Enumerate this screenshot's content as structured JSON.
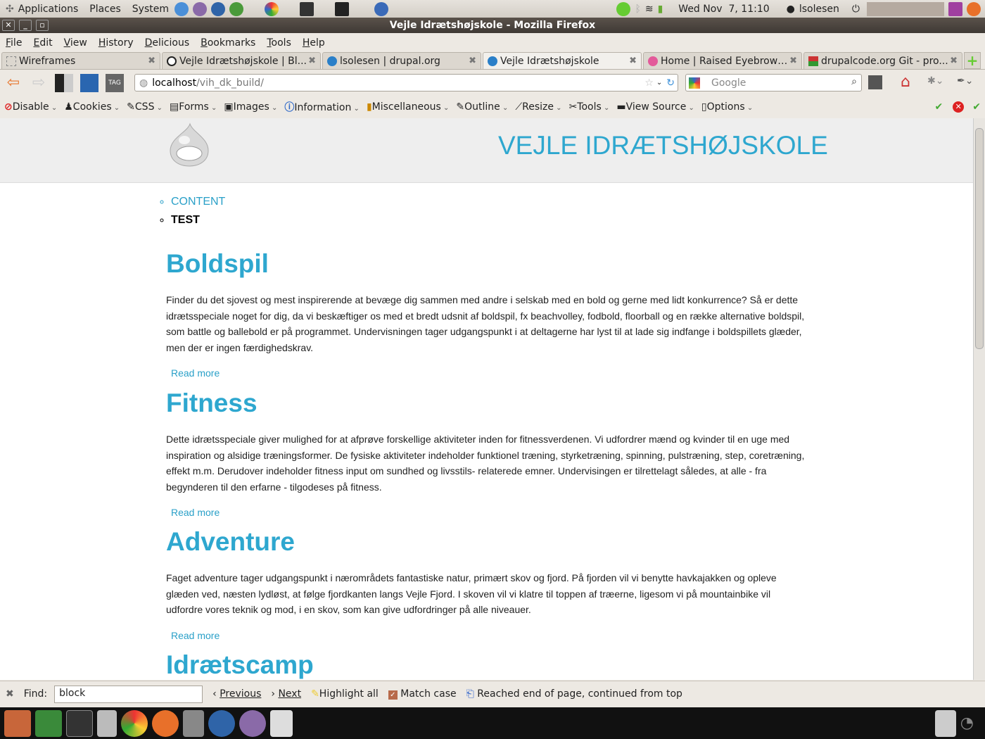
{
  "top_panel": {
    "menus": [
      "Applications",
      "Places",
      "System"
    ],
    "clock": "Wed Nov  7, 11:10",
    "user": "lsolesen"
  },
  "window": {
    "title": "Vejle Idrætshøjskole - Mozilla Firefox"
  },
  "menubar": [
    "File",
    "Edit",
    "View",
    "History",
    "Delicious",
    "Bookmarks",
    "Tools",
    "Help"
  ],
  "tabs": [
    {
      "label": "Wireframes",
      "active": false
    },
    {
      "label": "Vejle Idrætshøjskole | Bl...",
      "active": false
    },
    {
      "label": "lsolesen | drupal.org",
      "active": false
    },
    {
      "label": "Vejle Idrætshøjskole",
      "active": true
    },
    {
      "label": "Home | Raised Eyebrow ...",
      "active": false
    },
    {
      "label": "drupalcode.org Git - pro...",
      "active": false
    }
  ],
  "navbar": {
    "url_host": "localhost",
    "url_path": "/vih_dk_build/",
    "search_placeholder": "Google"
  },
  "devbar": [
    "Disable",
    "Cookies",
    "CSS",
    "Forms",
    "Images",
    "Information",
    "Miscellaneous",
    "Outline",
    "Resize",
    "Tools",
    "View Source",
    "Options"
  ],
  "page": {
    "site_name": "VEJLE IDRÆTSHØJSKOLE",
    "nav": [
      "CONTENT",
      "TEST"
    ],
    "articles": [
      {
        "title": "Boldspil",
        "body": "Finder du det sjovest og mest inspirerende at bevæge dig sammen med andre i selskab med en bold og gerne med lidt konkurrence? Så er dette idrætsspeciale noget for dig, da vi beskæftiger os med et bredt udsnit af boldspil, fx beachvolley, fodbold, floorball og en række alternative boldspil, som battle og ballebold er på programmet. Undervisningen tager udgangspunkt i at deltagerne har lyst til at lade sig indfange i boldspillets glæder, men der er ingen færdighedskrav.",
        "more": "Read more"
      },
      {
        "title": "Fitness",
        "body": "Dette idrætsspeciale giver mulighed for at afprøve forskellige aktiviteter inden for fitnessverdenen. Vi udfordrer mænd og kvinder til en uge med inspiration og alsidige træningsformer. De fysiske aktiviteter indeholder funktionel træning, styrketræning, spinning, pulstræning, step, coretræning, effekt m.m. Derudover indeholder fitness input om sundhed og livsstils- relaterede emner. Undervisingen er tilrettelagt således, at alle - fra begynderen til den erfarne - tilgodeses på fitness.",
        "more": "Read more"
      },
      {
        "title": "Adventure",
        "body": "Faget adventure tager udgangspunkt i nærområdets fantastiske natur, primært skov og fjord. På fjorden vil vi benytte havkajakken og opleve glæden ved, næsten lydløst, at følge fjordkanten langs Vejle Fjord. I skoven vil vi klatre til toppen af træerne, ligesom vi på mountainbike vil udfordre vores teknik og mod, i en skov, som kan give udfordringer på alle niveauer.",
        "more": "Read more"
      },
      {
        "title": "Idrætscamp"
      }
    ]
  },
  "findbar": {
    "label": "Find:",
    "value": "block",
    "previous": "Previous",
    "next": "Next",
    "highlight": "Highlight all",
    "match_case": "Match case",
    "match_case_checked": true,
    "status": "Reached end of page, continued from top"
  },
  "colors": {
    "accent": "#2ea7cf",
    "titlebar": "#4c4540",
    "chrome": "#ede9e3"
  }
}
